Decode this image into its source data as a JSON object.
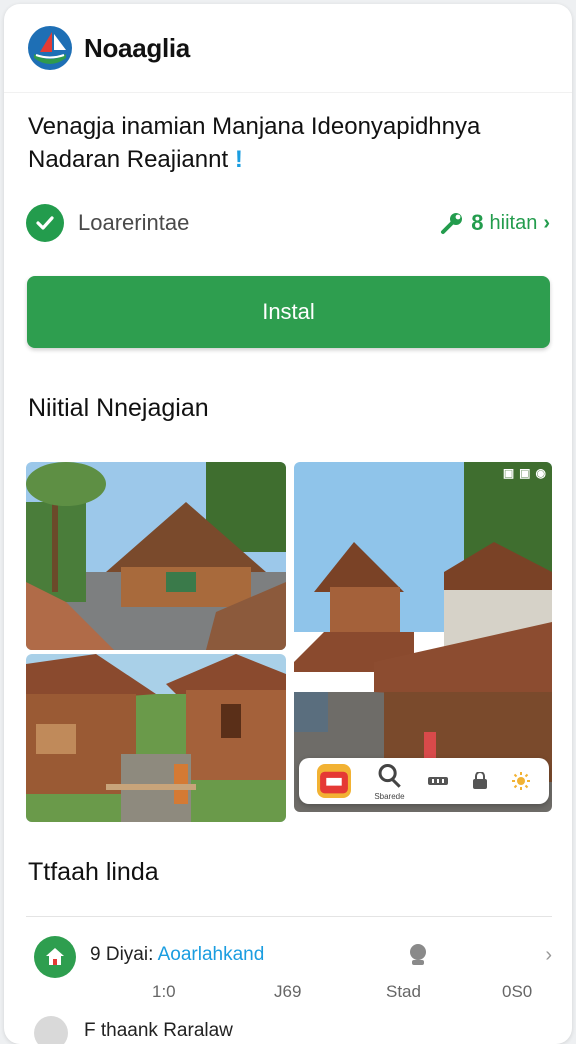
{
  "app": {
    "name": "Noaaglia",
    "logo_icon": "sailboat-globe-logo"
  },
  "headline": {
    "line1": "Venagja inamian Manjana Ideonyapidhnya",
    "line2": "Nadaran Reajiannt",
    "accent": "!"
  },
  "status": {
    "icon": "check-circle-icon",
    "text": "Loarerintae",
    "link_icon": "wrench-icon",
    "link_number": "8",
    "link_text": "hiitan",
    "link_chevron": "›"
  },
  "install_button": {
    "label": "Instal",
    "color": "#2e9e4f"
  },
  "gallery": {
    "title": "Niitial Nnejagian",
    "overlay_icons": [
      "▣",
      "▣",
      "◉"
    ],
    "dock": {
      "items": [
        {
          "icon": "store-icon",
          "label": ""
        },
        {
          "icon": "search-icon",
          "label": "Sbarede"
        },
        {
          "icon": "bars-icon",
          "label": ""
        },
        {
          "icon": "lock-icon",
          "label": ""
        },
        {
          "icon": "sun-icon",
          "label": ""
        }
      ]
    }
  },
  "reviews": {
    "title": "Ttfaah linda",
    "row": {
      "prefix": "9 Diyai:",
      "link": "Aoarlahkand",
      "stats": [
        "1:0",
        "J69",
        "Stad",
        "0S0"
      ],
      "chevron": "›"
    },
    "next_row": {
      "title": "F thaank Raralaw"
    }
  },
  "colors": {
    "accent_green": "#2e9e4f",
    "link_blue": "#1a9de0"
  }
}
